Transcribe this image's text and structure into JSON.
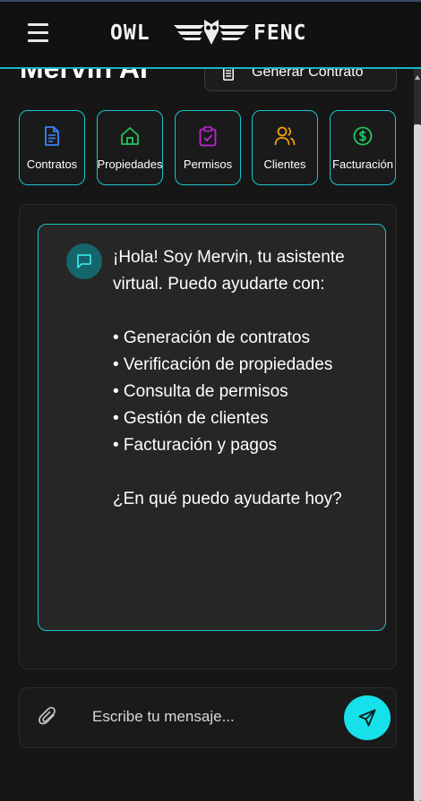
{
  "header": {
    "logo_left": "OWL",
    "logo_right": "FENC"
  },
  "page": {
    "title": "Mervin AI",
    "generate_button": "Generar Contrato"
  },
  "quick_actions": [
    {
      "label": "Contratos",
      "icon": "document-icon",
      "color": "#3b82f6"
    },
    {
      "label": "Propiedades",
      "icon": "home-icon",
      "color": "#22c55e"
    },
    {
      "label": "Permisos",
      "icon": "clipboard-check-icon",
      "color": "#c026d3"
    },
    {
      "label": "Clientes",
      "icon": "users-icon",
      "color": "#f59e0b"
    },
    {
      "label": "Facturación",
      "icon": "dollar-circle-icon",
      "color": "#22c55e"
    }
  ],
  "chat": {
    "messages": [
      {
        "from": "assistant",
        "intro": "¡Hola! Soy Mervin, tu asistente virtual. Puedo ayudarte con:",
        "items": [
          "• Generación de contratos",
          "• Verificación de propiedades",
          "• Consulta de permisos",
          "• Gestión de clientes",
          "• Facturación y pagos"
        ],
        "question": "¿En qué puedo ayudarte hoy?"
      }
    ]
  },
  "composer": {
    "placeholder": "Escribe tu mensaje..."
  },
  "colors": {
    "accent": "#18c6cc",
    "send_button": "#16e0ea",
    "background": "#161616"
  }
}
